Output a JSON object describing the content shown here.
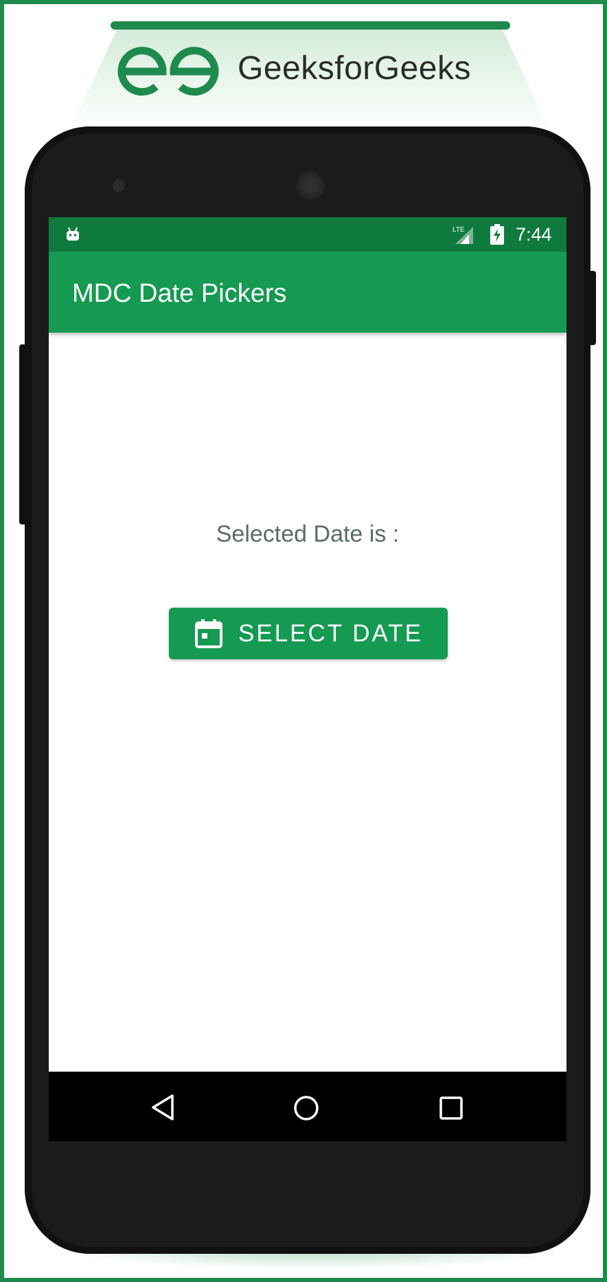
{
  "branding": {
    "logo_text": "GeeksforGeeks",
    "logo_icon": "geeksforgeeks-logo-icon",
    "accent_color": "#1e8a4c"
  },
  "status_bar": {
    "time": "7:44",
    "network_label": "LTE",
    "icons": [
      "android-debug-icon",
      "lte-signal-icon",
      "battery-charging-icon"
    ],
    "color": "#0f7a3d"
  },
  "app_bar": {
    "title": "MDC Date Pickers",
    "color": "#159a52"
  },
  "content": {
    "selected_date_label": "Selected Date is :",
    "select_date_button": {
      "label": "SELECT DATE",
      "icon": "calendar-icon"
    }
  },
  "navigation_bar": {
    "icons": [
      "back-icon",
      "home-icon",
      "recents-icon"
    ]
  }
}
